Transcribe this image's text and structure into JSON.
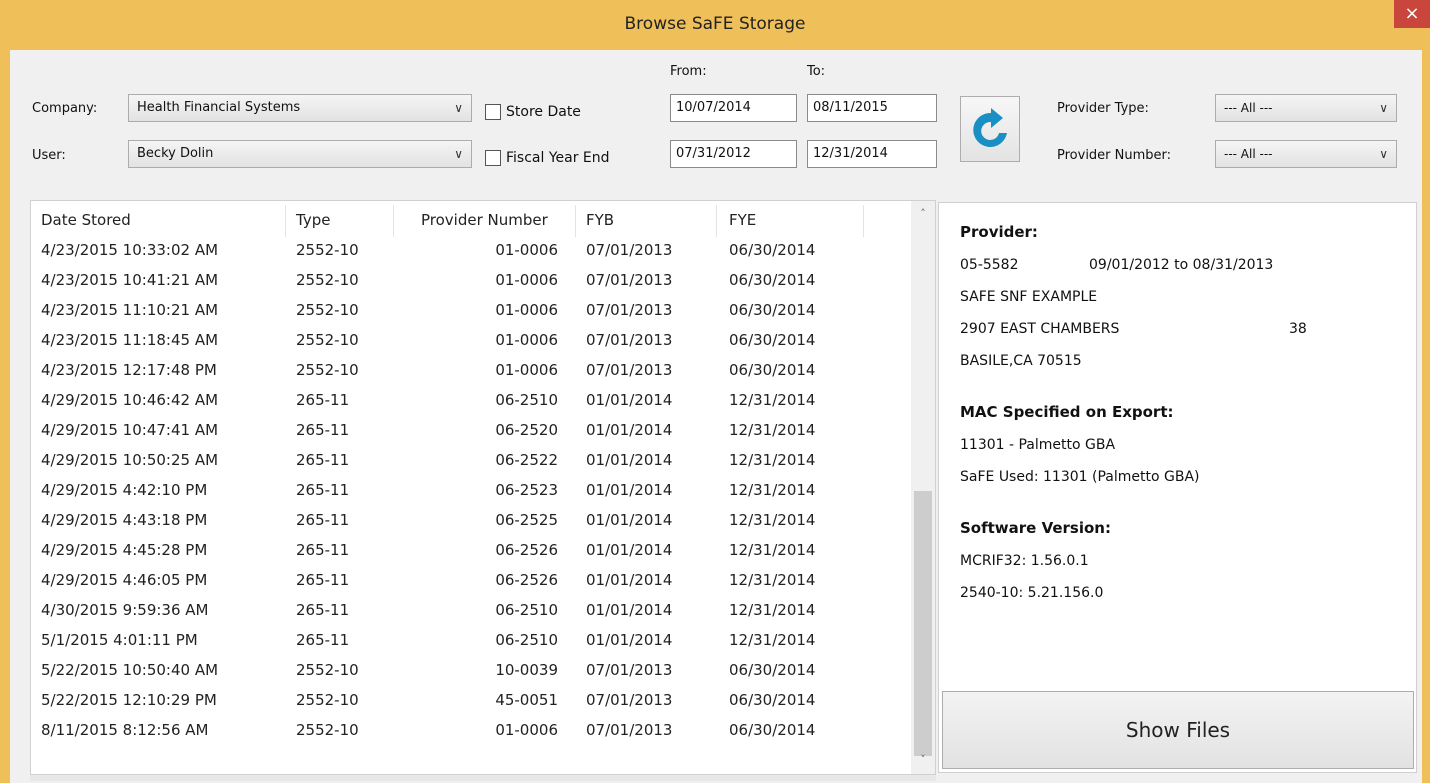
{
  "window": {
    "title": "Browse SaFE Storage",
    "close_glyph": "×"
  },
  "filters": {
    "company_label": "Company:",
    "company_value": "Health Financial Systems",
    "user_label": "User:",
    "user_value": "Becky Dolin",
    "store_date_label": "Store Date",
    "fiscal_year_end_label": "Fiscal Year End",
    "from_label": "From:",
    "to_label": "To:",
    "store_date_from": "10/07/2014",
    "store_date_to": "08/11/2015",
    "fye_from": "07/31/2012",
    "fye_to": "12/31/2014",
    "provider_type_label": "Provider Type:",
    "provider_type_value": "--- All ---",
    "provider_number_label": "Provider Number:",
    "provider_number_value": "--- All ---",
    "dropdown_glyph": "∨"
  },
  "list": {
    "columns": [
      "Date Stored",
      "Type",
      "Provider Number",
      "FYB",
      "FYE"
    ],
    "rows": [
      [
        "4/23/2015 10:33:02 AM",
        "2552-10",
        "01-0006",
        "07/01/2013",
        "06/30/2014"
      ],
      [
        "4/23/2015 10:41:21 AM",
        "2552-10",
        "01-0006",
        "07/01/2013",
        "06/30/2014"
      ],
      [
        "4/23/2015 11:10:21 AM",
        "2552-10",
        "01-0006",
        "07/01/2013",
        "06/30/2014"
      ],
      [
        "4/23/2015 11:18:45 AM",
        "2552-10",
        "01-0006",
        "07/01/2013",
        "06/30/2014"
      ],
      [
        "4/23/2015 12:17:48 PM",
        "2552-10",
        "01-0006",
        "07/01/2013",
        "06/30/2014"
      ],
      [
        "4/29/2015 10:46:42 AM",
        "265-11",
        "06-2510",
        "01/01/2014",
        "12/31/2014"
      ],
      [
        "4/29/2015 10:47:41 AM",
        "265-11",
        "06-2520",
        "01/01/2014",
        "12/31/2014"
      ],
      [
        "4/29/2015 10:50:25 AM",
        "265-11",
        "06-2522",
        "01/01/2014",
        "12/31/2014"
      ],
      [
        "4/29/2015 4:42:10 PM",
        "265-11",
        "06-2523",
        "01/01/2014",
        "12/31/2014"
      ],
      [
        "4/29/2015 4:43:18 PM",
        "265-11",
        "06-2525",
        "01/01/2014",
        "12/31/2014"
      ],
      [
        "4/29/2015 4:45:28 PM",
        "265-11",
        "06-2526",
        "01/01/2014",
        "12/31/2014"
      ],
      [
        "4/29/2015 4:46:05 PM",
        "265-11",
        "06-2526",
        "01/01/2014",
        "12/31/2014"
      ],
      [
        "4/30/2015 9:59:36 AM",
        "265-11",
        "06-2510",
        "01/01/2014",
        "12/31/2014"
      ],
      [
        "5/1/2015 4:01:11 PM",
        "265-11",
        "06-2510",
        "01/01/2014",
        "12/31/2014"
      ],
      [
        "5/22/2015 10:50:40 AM",
        "2552-10",
        "10-0039",
        "07/01/2013",
        "06/30/2014"
      ],
      [
        "5/22/2015 12:10:29 PM",
        "2552-10",
        "45-0051",
        "07/01/2013",
        "06/30/2014"
      ],
      [
        "8/11/2015 8:12:56 AM",
        "2552-10",
        "01-0006",
        "07/01/2013",
        "06/30/2014"
      ]
    ],
    "scroll_up_glyph": "˄",
    "scroll_down_glyph": "˅"
  },
  "details": {
    "provider_heading": "Provider:",
    "provider_number": "05-5582",
    "provider_period": "09/01/2012 to 08/31/2013",
    "provider_name": "SAFE SNF EXAMPLE",
    "provider_address": "2907 EAST CHAMBERS",
    "provider_address_extra": "38",
    "provider_city": "BASILE,CA 70515",
    "mac_heading": "MAC Specified on Export:",
    "mac_value": "11301 - Palmetto GBA",
    "safe_used": "SaFE Used: 11301 (Palmetto GBA)",
    "software_heading": "Software Version:",
    "mcrif_version": "MCRIF32: 1.56.0.1",
    "form_version": "2540-10: 5.21.156.0",
    "show_files_label": "Show Files"
  },
  "colors": {
    "title_bar": "#efc05a",
    "desktop": "#1d3f9c",
    "close_button": "#c9463d",
    "refresh_icon": "#1a8fc4"
  }
}
